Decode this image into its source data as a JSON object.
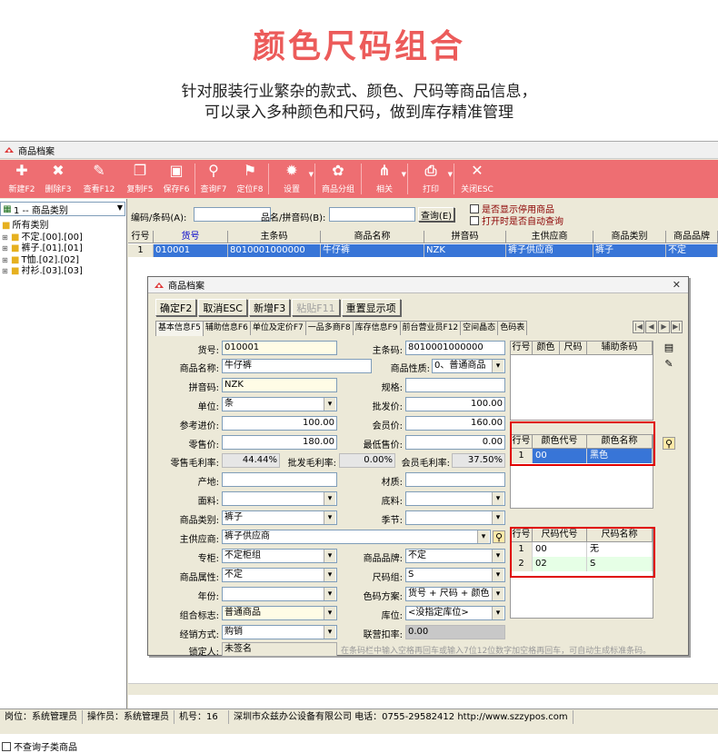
{
  "promo": {
    "title": "颜色尺码组合",
    "line1": "针对服装行业繁杂的款式、颜色、尺码等商品信息，",
    "line2": "可以录入多种颜色和尺码，做到库存精准管理"
  },
  "window": {
    "title": "商品档案"
  },
  "toolbar": [
    {
      "label": "新建F2",
      "icon": "new-doc-icon",
      "glyph": "✚"
    },
    {
      "label": "删除F3",
      "icon": "delete-icon",
      "glyph": "✖"
    },
    {
      "label": "查看F12",
      "icon": "edit-icon",
      "glyph": "✎"
    },
    {
      "label": "复制F5",
      "icon": "copy-icon",
      "glyph": "❐"
    },
    {
      "label": "保存F6",
      "icon": "save-icon",
      "glyph": "▣"
    },
    {
      "label": "查询F7",
      "icon": "search-icon",
      "glyph": "⚲"
    },
    {
      "label": "定位F8",
      "icon": "location-pin-icon",
      "glyph": "⚑"
    },
    {
      "label": "设置",
      "icon": "gear-icon",
      "glyph": "✹"
    },
    {
      "label": "商品分组",
      "icon": "palette-icon",
      "glyph": "✿"
    },
    {
      "label": "相关",
      "icon": "share-icon",
      "glyph": "⋔"
    },
    {
      "label": "打印",
      "icon": "printer-icon",
      "glyph": "⎙"
    },
    {
      "label": "关闭ESC",
      "icon": "close-icon",
      "glyph": "✕"
    }
  ],
  "left": {
    "category_select": "1 -- 商品类别",
    "tree": [
      {
        "label": "所有类别",
        "level": 0
      },
      {
        "label": "不定.[00].[00]",
        "level": 1
      },
      {
        "label": "裤子.[01].[01]",
        "level": 1
      },
      {
        "label": "T恤.[02].[02]",
        "level": 1
      },
      {
        "label": "衬衫.[03].[03]",
        "level": 1
      }
    ],
    "no_subcat_label": "不查询子类商品"
  },
  "search": {
    "code_label": "编码/条码(A):",
    "name_label": "品名/拼音码(B):",
    "query_button": "查询(E)",
    "chk_disabled": "是否显示停用商品",
    "chk_auto": "打开时是否自动查询"
  },
  "grid": {
    "headers": [
      "行号",
      "货号",
      "主条码",
      "商品名称",
      "拼音码",
      "主供应商",
      "商品类别",
      "商品品牌"
    ],
    "rows": [
      [
        "1",
        "010001",
        "8010001000000",
        "牛仔裤",
        "NZK",
        "裤子供应商",
        "裤子",
        "不定"
      ]
    ]
  },
  "status": {
    "post": "岗位：系统管理员",
    "operator": "操作员：系统管理员",
    "machine": "机号：16",
    "company": "深圳市众兹办公设备有限公司 电话：0755-29582412 http://www.szzypos.com"
  },
  "dialog": {
    "title": "商品档案",
    "buttons": [
      "确定F2",
      "取消ESC",
      "新增F3",
      "粘贴F11",
      "重置显示项"
    ],
    "tabs": [
      "基本信息F5",
      "辅助信息F6",
      "单位及定价F7",
      "一品多商F8",
      "库存信息F9",
      "前台营业员F12",
      "空间晶态",
      "色码表"
    ],
    "fields": {
      "item_no_label": "货号:",
      "item_no": "010001",
      "barcode_label": "主条码:",
      "barcode": "8010001000000",
      "name_label": "商品名称:",
      "name": "牛仔裤",
      "nature_label": "商品性质:",
      "nature": "0、普通商品",
      "pinyin_label": "拼音码:",
      "pinyin": "NZK",
      "spec_label": "规格:",
      "spec": "",
      "unit_label": "单位:",
      "unit": "条",
      "wholesale_label": "批发价:",
      "wholesale": "100.00",
      "cost_label": "参考进价:",
      "cost": "100.00",
      "member_label": "会员价:",
      "member": "160.00",
      "retail_label": "零售价:",
      "retail": "180.00",
      "min_price_label": "最低售价:",
      "min_price": "0.00",
      "retail_margin_label": "零售毛利率:",
      "retail_margin": "44.44%",
      "wholesale_margin_label": "批发毛利率:",
      "wholesale_margin": "0.00%",
      "member_margin_label": "会员毛利率:",
      "member_margin": "37.50%",
      "origin_label": "产地:",
      "material_label": "材质:",
      "fabric_label": "面料:",
      "lining_label": "底料:",
      "category_label": "商品类别:",
      "category": "裤子",
      "season_label": "季节:",
      "supplier_label": "主供应商:",
      "supplier": "裤子供应商",
      "counter_label": "专柜:",
      "counter": "不定柜组",
      "brand_label": "商品品牌:",
      "brand": "不定",
      "attr_label": "商品属性:",
      "attr": "不定",
      "sizegroup_label": "尺码组:",
      "sizegroup": "S",
      "year_label": "年份:",
      "scheme_label": "色码方案:",
      "scheme": "货号 + 尺码 + 颜色",
      "combo_label": "组合标志:",
      "combo": "普通商品",
      "location_label": "库位:",
      "location": "<没指定库位>",
      "sale_mode_label": "经销方式:",
      "sale_mode": "购销",
      "deduct_label": "联营扣率:",
      "deduct": "0.00",
      "lock_label": "锁定人:",
      "lock": "未签名"
    },
    "aux_headers": [
      "行号",
      "颜色",
      "尺码",
      "辅助条码"
    ],
    "color_headers": [
      "行号",
      "颜色代号",
      "颜色名称"
    ],
    "colors": [
      [
        "1",
        "00",
        "黑色"
      ]
    ],
    "size_headers": [
      "行号",
      "尺码代号",
      "尺码名称"
    ],
    "sizes": [
      [
        "1",
        "00",
        "无"
      ],
      [
        "2",
        "02",
        "S"
      ]
    ],
    "hint": "在条码栏中输入空格再回车或输入7位12位数字加空格再回车，可自动生成标准条码。"
  },
  "colors": {
    "toolbar_bg": "#ee6e72",
    "promo_title": "#ec5b5a",
    "highlight_box": "#e00000",
    "selected_row": "#3875d7"
  }
}
